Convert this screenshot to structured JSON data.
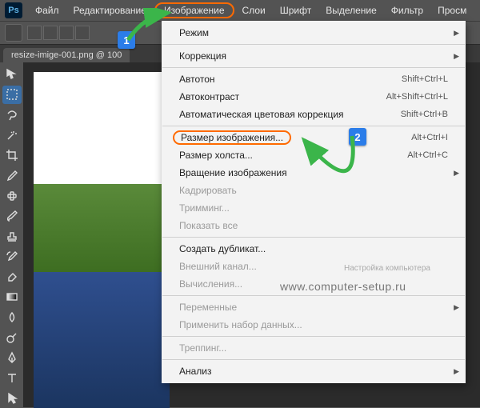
{
  "app": {
    "logo": "Ps"
  },
  "menubar": [
    "Файл",
    "Редактирование",
    "Изображение",
    "Слои",
    "Шрифт",
    "Выделение",
    "Фильтр",
    "Просм"
  ],
  "highlighted_menu_index": 2,
  "doctab": "resize-imige-001.png @ 100",
  "dropdown": {
    "groups": [
      [
        {
          "label": "Режим",
          "submenu": true
        }
      ],
      [
        {
          "label": "Коррекция",
          "submenu": true
        }
      ],
      [
        {
          "label": "Автотон",
          "shortcut": "Shift+Ctrl+L"
        },
        {
          "label": "Автоконтраст",
          "shortcut": "Alt+Shift+Ctrl+L"
        },
        {
          "label": "Автоматическая цветовая коррекция",
          "shortcut": "Shift+Ctrl+B"
        }
      ],
      [
        {
          "label": "Размер изображения...",
          "shortcut": "Alt+Ctrl+I",
          "highlight": true
        },
        {
          "label": "Размер холста...",
          "shortcut": "Alt+Ctrl+C"
        },
        {
          "label": "Вращение изображения",
          "submenu": true
        },
        {
          "label": "Кадрировать",
          "disabled": true
        },
        {
          "label": "Тримминг...",
          "disabled": true
        },
        {
          "label": "Показать все",
          "disabled": true
        }
      ],
      [
        {
          "label": "Создать дубликат..."
        },
        {
          "label": "Внешний канал...",
          "disabled": true
        },
        {
          "label": "Вычисления...",
          "disabled": true
        }
      ],
      [
        {
          "label": "Переменные",
          "submenu": true,
          "disabled": true
        },
        {
          "label": "Применить набор данных...",
          "disabled": true
        }
      ],
      [
        {
          "label": "Треппинг...",
          "disabled": true
        }
      ],
      [
        {
          "label": "Анализ",
          "submenu": true
        }
      ]
    ]
  },
  "callouts": {
    "one": "1",
    "two": "2"
  },
  "tools": [
    "move",
    "marquee",
    "lasso",
    "wand",
    "crop",
    "eyedrop",
    "heal",
    "brush",
    "stamp",
    "history",
    "eraser",
    "gradient",
    "blur",
    "dodge",
    "pen",
    "text",
    "path",
    "shape",
    "hand",
    "zoom"
  ],
  "watermark": "www.computer-setup.ru",
  "watermark2": "Настройка компьютера"
}
